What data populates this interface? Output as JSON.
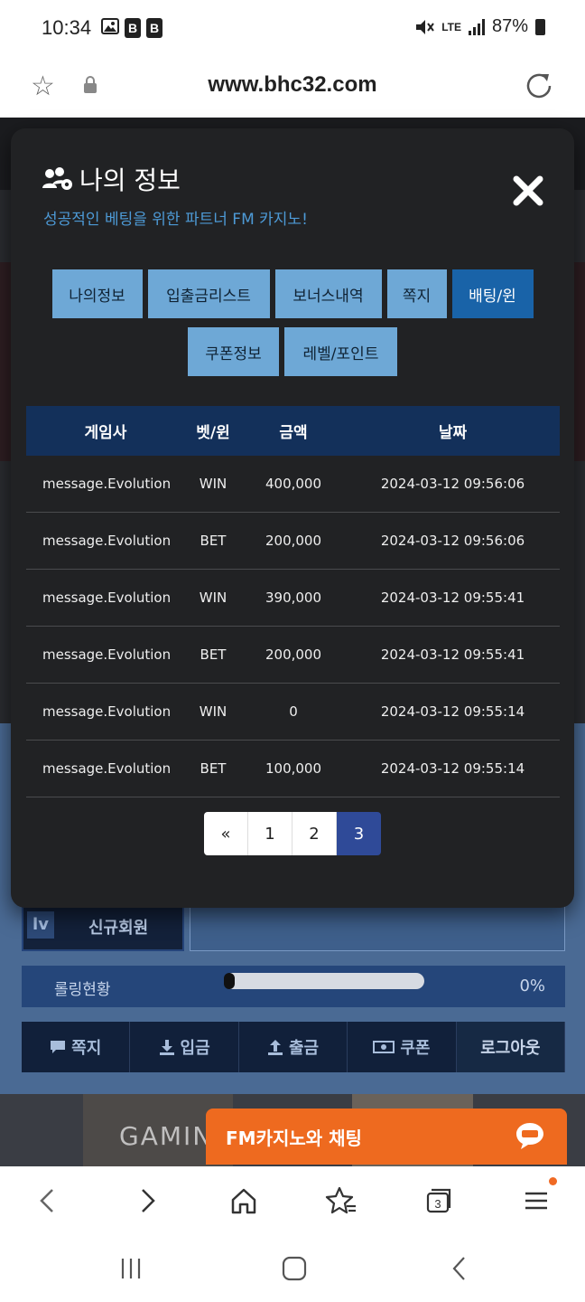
{
  "status_bar": {
    "time": "10:34",
    "battery": "87%",
    "network": "LTE"
  },
  "browser": {
    "url": "www.bhc32.com"
  },
  "modal": {
    "title": "나의 정보",
    "subtitle": "성공적인 베팅을 위한 파트너 FM 카지노!",
    "tabs_row1": [
      {
        "label": "나의정보",
        "active": false
      },
      {
        "label": "입출금리스트",
        "active": false
      },
      {
        "label": "보너스내역",
        "active": false
      },
      {
        "label": "쪽지",
        "active": false
      },
      {
        "label": "배팅/윈",
        "active": true
      }
    ],
    "tabs_row2": [
      {
        "label": "쿠폰정보",
        "active": false
      },
      {
        "label": "레벨/포인트",
        "active": false
      }
    ],
    "table": {
      "headers": [
        "게임사",
        "벳/윈",
        "금액",
        "날짜"
      ],
      "rows": [
        [
          "message.Evolution",
          "WIN",
          "400,000",
          "2024-03-12 09:56:06"
        ],
        [
          "message.Evolution",
          "BET",
          "200,000",
          "2024-03-12 09:56:06"
        ],
        [
          "message.Evolution",
          "WIN",
          "390,000",
          "2024-03-12 09:55:41"
        ],
        [
          "message.Evolution",
          "BET",
          "200,000",
          "2024-03-12 09:55:41"
        ],
        [
          "message.Evolution",
          "WIN",
          "0",
          "2024-03-12 09:55:14"
        ],
        [
          "message.Evolution",
          "BET",
          "100,000",
          "2024-03-12 09:55:14"
        ]
      ]
    },
    "pagination": {
      "prev": "«",
      "pages": [
        "1",
        "2",
        "3"
      ],
      "current": "3"
    }
  },
  "background": {
    "level_tag": "lv",
    "level_name": "신규회원",
    "rolling_label": "롤링현황",
    "rolling_percent": "0%",
    "rolling_value": 0,
    "actions": [
      "쪽지",
      "입금",
      "출금",
      "쿠폰",
      "로그아웃"
    ],
    "thumb_text": "GAMIN",
    "chat_label": "FM카지노와 채팅"
  },
  "colors": {
    "accent_blue": "#1963a8",
    "tab_blue": "#6ea8d6",
    "header_navy": "#13305a",
    "chat_orange": "#ee6a1f",
    "modal_bg": "#212224"
  }
}
